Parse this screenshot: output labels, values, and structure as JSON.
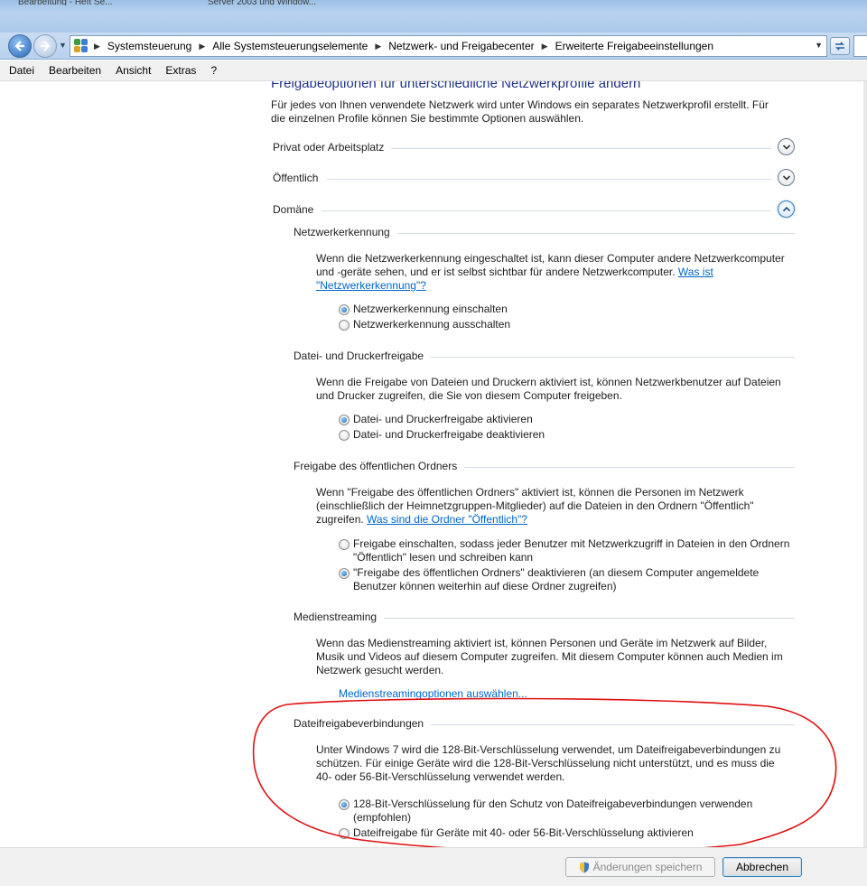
{
  "window": {
    "tabs": [
      "Bearbeitung - Heft Se...",
      "Server 2003 und Window..."
    ]
  },
  "addressbar": {
    "breadcrumbs": [
      "Systemsteuerung",
      "Alle Systemsteuerungselemente",
      "Netzwerk- und Freigabecenter",
      "Erweiterte Freigabeeinstellungen"
    ]
  },
  "menu": [
    "Datei",
    "Bearbeiten",
    "Ansicht",
    "Extras",
    "?"
  ],
  "page": {
    "title": "Freigabeoptionen für unterschiedliche Netzwerkprofile ändern",
    "intro": "Für jedes von Ihnen verwendete Netzwerk wird unter Windows ein separates Netzwerkprofil erstellt. Für die einzelnen Profile können Sie bestimmte Optionen auswählen."
  },
  "profiles": [
    {
      "label": "Privat oder Arbeitsplatz",
      "expanded": false
    },
    {
      "label": "Öffentlich",
      "expanded": false
    },
    {
      "label": "Domäne",
      "expanded": true
    }
  ],
  "sections": {
    "discovery": {
      "title": "Netzwerkerkennung",
      "desc": "Wenn die Netzwerkerkennung eingeschaltet ist, kann dieser Computer andere Netzwerkcomputer und -geräte sehen, und er ist selbst sichtbar für andere Netzwerkcomputer.",
      "link": "Was ist \"Netzwerkerkennung\"?",
      "opt_on": "Netzwerkerkennung einschalten",
      "opt_off": "Netzwerkerkennung ausschalten",
      "selected": 0
    },
    "printer": {
      "title": "Datei- und Druckerfreigabe",
      "desc": "Wenn die Freigabe von Dateien und Druckern aktiviert ist, können Netzwerkbenutzer auf Dateien und Drucker zugreifen, die Sie von diesem Computer freigeben.",
      "opt_on": "Datei- und Druckerfreigabe aktivieren",
      "opt_off": "Datei- und Druckerfreigabe deaktivieren",
      "selected": 0
    },
    "public": {
      "title": "Freigabe des öffentlichen Ordners",
      "desc": "Wenn \"Freigabe des öffentlichen Ordners\" aktiviert ist, können die Personen im Netzwerk (einschließlich der Heimnetzgruppen-Mitglieder) auf die Dateien in den Ordnern \"Öffentlich\" zugreifen.",
      "link": "Was sind die Ordner \"Öffentlich\"?",
      "opt_on": "Freigabe einschalten, sodass jeder Benutzer mit Netzwerkzugriff in Dateien in den Ordnern \"Öffentlich\" lesen und schreiben kann",
      "opt_off": "\"Freigabe des öffentlichen Ordners\" deaktivieren (an diesem Computer angemeldete Benutzer können weiterhin auf diese Ordner zugreifen)",
      "selected": 1
    },
    "media": {
      "title": "Medienstreaming",
      "desc": "Wenn das Medienstreaming aktiviert ist, können Personen und Geräte im Netzwerk auf Bilder, Musik und Videos auf diesem Computer zugreifen. Mit diesem Computer können auch Medien im Netzwerk gesucht werden.",
      "link": "Medienstreamingoptionen auswählen..."
    },
    "connections": {
      "title": "Dateifreigabeverbindungen",
      "desc": "Unter Windows 7 wird die 128-Bit-Verschlüsselung verwendet, um Dateifreigabeverbindungen zu schützen. Für einige Geräte wird die 128-Bit-Verschlüsselung nicht unterstützt, und es muss die 40- oder 56-Bit-Verschlüsselung verwendet werden.",
      "opt_on": "128-Bit-Verschlüsselung für den Schutz von Dateifreigabeverbindungen verwenden (empfohlen)",
      "opt_off": "Dateifreigabe für Geräte mit 40- oder 56-Bit-Verschlüsselung aktivieren",
      "selected": 0
    }
  },
  "buttons": {
    "save": "Änderungen speichern",
    "apply": "Abbrechen"
  },
  "colors": {
    "title": "#1e3287",
    "link": "#0066cc",
    "annotation": "#e01010"
  }
}
